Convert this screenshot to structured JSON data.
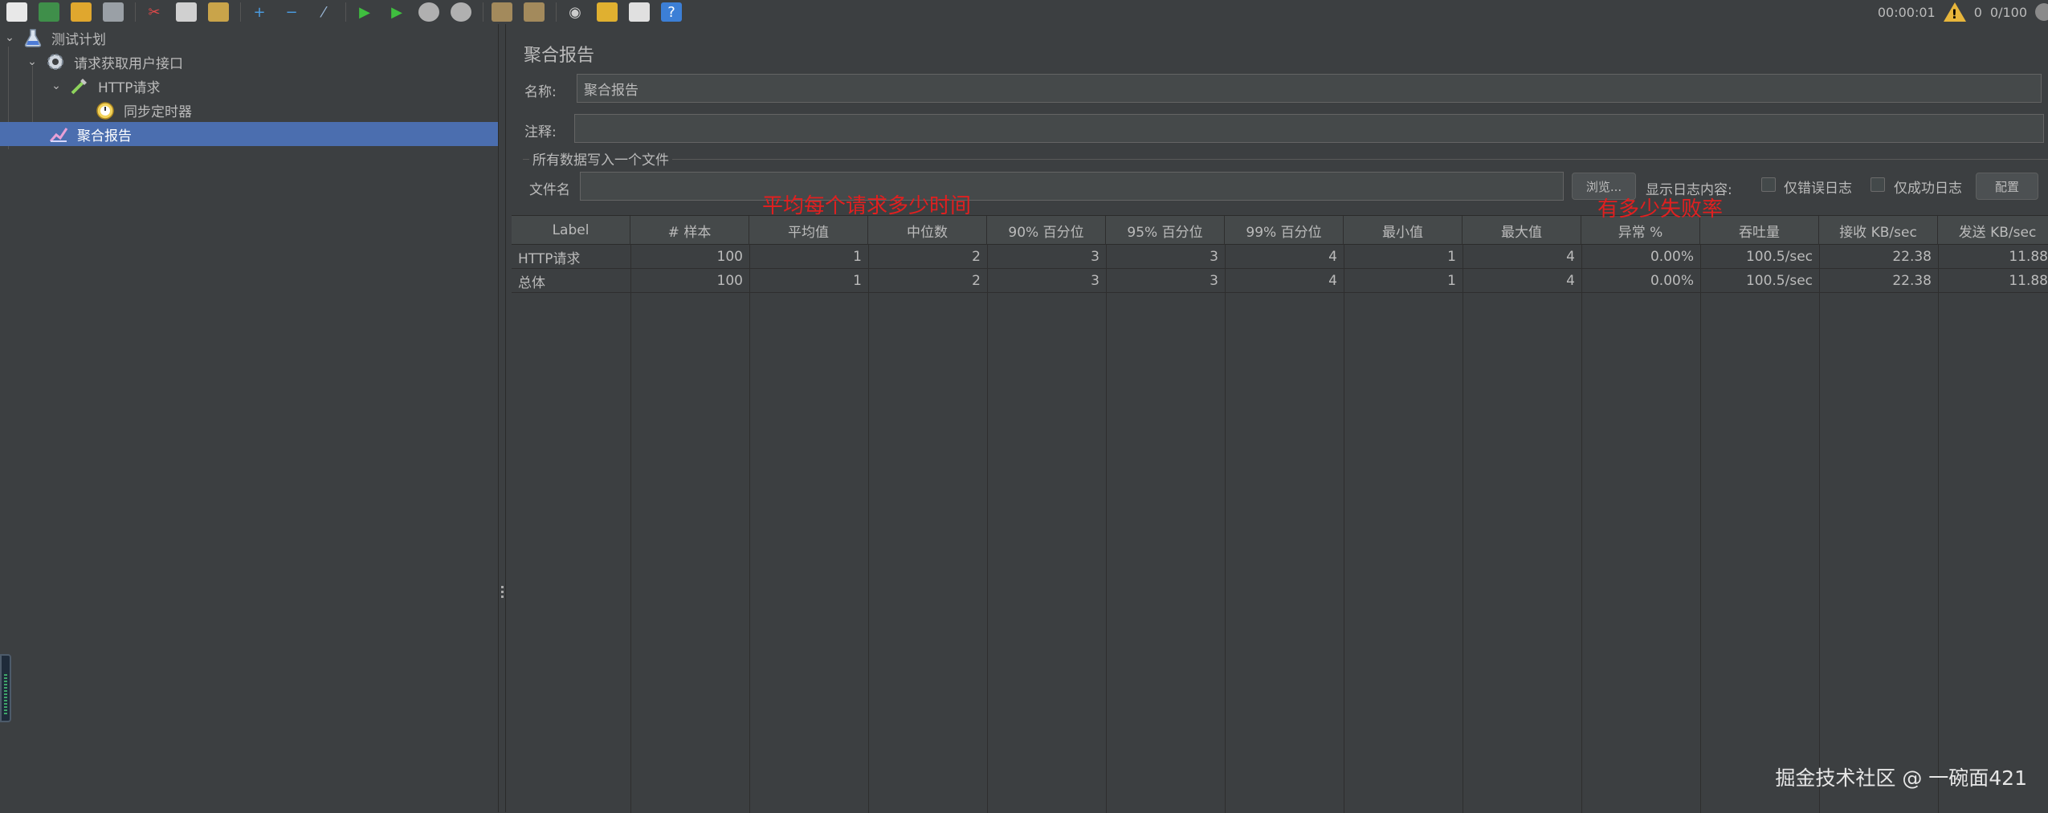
{
  "toolbar": {
    "icons": [
      "new-icon",
      "templates-icon",
      "open-icon",
      "save-icon",
      "cut-icon",
      "copy-icon",
      "paste-icon",
      "expand-icon",
      "collapse-icon",
      "toggle-icon",
      "start-icon",
      "start-no-pause-icon",
      "stop-icon",
      "shutdown-icon",
      "clear-icon",
      "clear-all-icon",
      "search-icon",
      "reset-search-icon",
      "function-helper-icon",
      "help-icon"
    ],
    "timer": "00:00:01",
    "warnings": "0",
    "threads": "0/100"
  },
  "tree": {
    "items": [
      {
        "label": "测试计划",
        "icon": "flask-icon"
      },
      {
        "label": "请求获取用户接口",
        "icon": "gear-icon"
      },
      {
        "label": "HTTP请求",
        "icon": "pipette-icon"
      },
      {
        "label": "同步定时器",
        "icon": "stopwatch-icon"
      },
      {
        "label": "聚合报告",
        "icon": "chart-icon"
      }
    ]
  },
  "panel": {
    "title": "聚合报告",
    "name_label": "名称:",
    "name_value": "聚合报告",
    "comment_label": "注释:",
    "comment_value": "",
    "group_title": "所有数据写入一个文件",
    "filename_label": "文件名",
    "filename_value": "",
    "browse_label": "浏览...",
    "log_display_label": "显示日志内容:",
    "errors_only_label": "仅错误日志",
    "success_only_label": "仅成功日志",
    "configure_label": "配置"
  },
  "annotations": {
    "avg_note": "平均每个请求多少时间",
    "fail_note": "有多少失败率"
  },
  "table": {
    "headers": [
      "Label",
      "# 样本",
      "平均值",
      "中位数",
      "90% 百分位",
      "95% 百分位",
      "99% 百分位",
      "最小值",
      "最大值",
      "异常 %",
      "吞吐量",
      "接收 KB/sec",
      "发送 KB/sec"
    ],
    "rows": [
      [
        "HTTP请求",
        "100",
        "1",
        "2",
        "3",
        "3",
        "4",
        "1",
        "4",
        "0.00%",
        "100.5/sec",
        "22.38",
        "11.88"
      ],
      [
        "总体",
        "100",
        "1",
        "2",
        "3",
        "3",
        "4",
        "1",
        "4",
        "0.00%",
        "100.5/sec",
        "22.38",
        "11.88"
      ]
    ]
  },
  "watermark": "掘金技术社区 @ 一碗面421"
}
